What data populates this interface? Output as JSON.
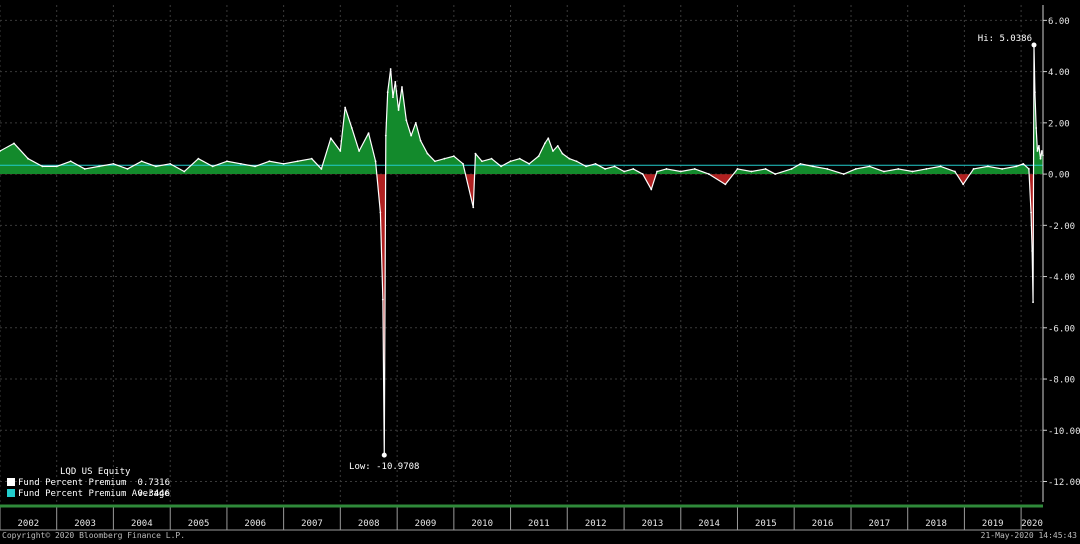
{
  "chart_data": {
    "type": "area",
    "title": "",
    "xlabel": "",
    "ylabel": "",
    "x_range": [
      "2002-01-01",
      "2020-05-21"
    ],
    "ylim": [
      -12.8,
      6.6
    ],
    "y_ticks": [
      6.0,
      4.0,
      2.0,
      0.0,
      -2.0,
      -4.0,
      -6.0,
      -8.0,
      -10.0,
      -12.0
    ],
    "y_tick_labels": [
      "6.00",
      "4.00",
      "2.00",
      "0.00",
      "-2.00",
      "-4.00",
      "-6.00",
      "-8.00",
      "-10.00",
      "-12.00"
    ],
    "year_labels": [
      "2002",
      "2003",
      "2004",
      "2005",
      "2006",
      "2007",
      "2008",
      "2009",
      "2010",
      "2011",
      "2012",
      "2013",
      "2014",
      "2015",
      "2016",
      "2017",
      "2018",
      "2019",
      "2020"
    ],
    "grid": true,
    "legend": {
      "position": "bottom-left",
      "title": "LQD US Equity",
      "entries": [
        {
          "label": "Fund Percent Premium",
          "value": "0.7316",
          "color": "#ffffff"
        },
        {
          "label": "Fund Percent Premium Average",
          "value": "0.3446",
          "color": "#22cccc"
        }
      ]
    },
    "annotations": {
      "high": {
        "text": "Hi: 5.0386",
        "x": "2020-03-24",
        "y": 5.0386
      },
      "low": {
        "text": "Low: -10.9708",
        "x": "2008-10-10",
        "y": -10.9708
      }
    },
    "series": [
      {
        "name": "Fund Percent Premium",
        "color": "#ffffff",
        "fill_positive": "#138a2c",
        "fill_negative": "#b02020",
        "x": [
          "2002-01-01",
          "2002-04-01",
          "2002-07-01",
          "2002-10-01",
          "2003-01-01",
          "2003-04-01",
          "2003-07-01",
          "2003-10-01",
          "2004-01-01",
          "2004-04-01",
          "2004-07-01",
          "2004-10-01",
          "2005-01-01",
          "2005-04-01",
          "2005-07-01",
          "2005-10-01",
          "2006-01-01",
          "2006-04-01",
          "2006-07-01",
          "2006-10-01",
          "2007-01-01",
          "2007-04-01",
          "2007-07-01",
          "2007-09-01",
          "2007-11-01",
          "2008-01-01",
          "2008-02-01",
          "2008-03-15",
          "2008-05-01",
          "2008-07-01",
          "2008-08-15",
          "2008-09-15",
          "2008-10-01",
          "2008-10-10",
          "2008-10-20",
          "2008-11-01",
          "2008-11-20",
          "2008-12-05",
          "2008-12-20",
          "2009-01-10",
          "2009-02-01",
          "2009-03-01",
          "2009-04-01",
          "2009-05-01",
          "2009-06-01",
          "2009-07-15",
          "2009-09-01",
          "2009-11-01",
          "2010-01-01",
          "2010-03-01",
          "2010-05-06",
          "2010-05-20",
          "2010-07-01",
          "2010-09-01",
          "2010-11-01",
          "2011-01-01",
          "2011-03-01",
          "2011-05-01",
          "2011-07-01",
          "2011-08-10",
          "2011-09-01",
          "2011-10-01",
          "2011-11-01",
          "2011-12-01",
          "2012-01-15",
          "2012-03-01",
          "2012-05-01",
          "2012-07-01",
          "2012-09-01",
          "2012-11-01",
          "2013-01-01",
          "2013-03-01",
          "2013-05-01",
          "2013-06-25",
          "2013-08-01",
          "2013-10-01",
          "2014-01-01",
          "2014-04-01",
          "2014-07-01",
          "2014-10-15",
          "2015-01-01",
          "2015-04-01",
          "2015-07-01",
          "2015-09-01",
          "2015-12-15",
          "2016-02-10",
          "2016-05-01",
          "2016-08-01",
          "2016-11-15",
          "2017-02-01",
          "2017-05-01",
          "2017-08-01",
          "2017-11-01",
          "2018-02-01",
          "2018-05-01",
          "2018-08-01",
          "2018-11-01",
          "2018-12-24",
          "2019-03-01",
          "2019-06-01",
          "2019-09-01",
          "2019-12-01",
          "2020-01-15",
          "2020-02-20",
          "2020-03-05",
          "2020-03-12",
          "2020-03-18",
          "2020-03-24",
          "2020-03-30",
          "2020-04-07",
          "2020-04-15",
          "2020-04-25",
          "2020-05-05",
          "2020-05-14",
          "2020-05-21"
        ],
        "y": [
          0.9,
          1.2,
          0.6,
          0.3,
          0.3,
          0.5,
          0.2,
          0.3,
          0.4,
          0.2,
          0.5,
          0.3,
          0.4,
          0.1,
          0.6,
          0.3,
          0.5,
          0.4,
          0.3,
          0.5,
          0.4,
          0.5,
          0.6,
          0.2,
          1.4,
          0.9,
          2.6,
          1.8,
          0.9,
          1.6,
          0.5,
          -1.5,
          -4.9,
          -10.9708,
          1.5,
          3.2,
          4.1,
          3.0,
          3.6,
          2.5,
          3.4,
          2.1,
          1.5,
          2.0,
          1.3,
          0.8,
          0.5,
          0.6,
          0.7,
          0.4,
          -1.3,
          0.8,
          0.5,
          0.6,
          0.3,
          0.5,
          0.6,
          0.4,
          0.7,
          1.2,
          1.4,
          0.9,
          1.1,
          0.8,
          0.6,
          0.5,
          0.3,
          0.4,
          0.2,
          0.3,
          0.1,
          0.2,
          0.0,
          -0.6,
          0.1,
          0.2,
          0.1,
          0.2,
          0.0,
          -0.4,
          0.2,
          0.1,
          0.2,
          0.0,
          0.2,
          0.4,
          0.3,
          0.2,
          0.0,
          0.2,
          0.3,
          0.1,
          0.2,
          0.1,
          0.2,
          0.3,
          0.1,
          -0.4,
          0.2,
          0.3,
          0.2,
          0.3,
          0.4,
          0.2,
          -1.5,
          -3.0,
          -5.0,
          5.0386,
          3.2,
          1.8,
          0.9,
          1.1,
          0.6,
          0.9,
          0.7316
        ]
      },
      {
        "name": "Fund Percent Premium Average",
        "color": "#22cccc",
        "x": [
          "2002-01-01",
          "2020-05-21"
        ],
        "y": [
          0.3446,
          0.3446
        ]
      }
    ]
  },
  "footer": {
    "copyright": "Copyright© 2020 Bloomberg Finance L.P.",
    "timestamp": "21-May-2020 14:45:43"
  }
}
